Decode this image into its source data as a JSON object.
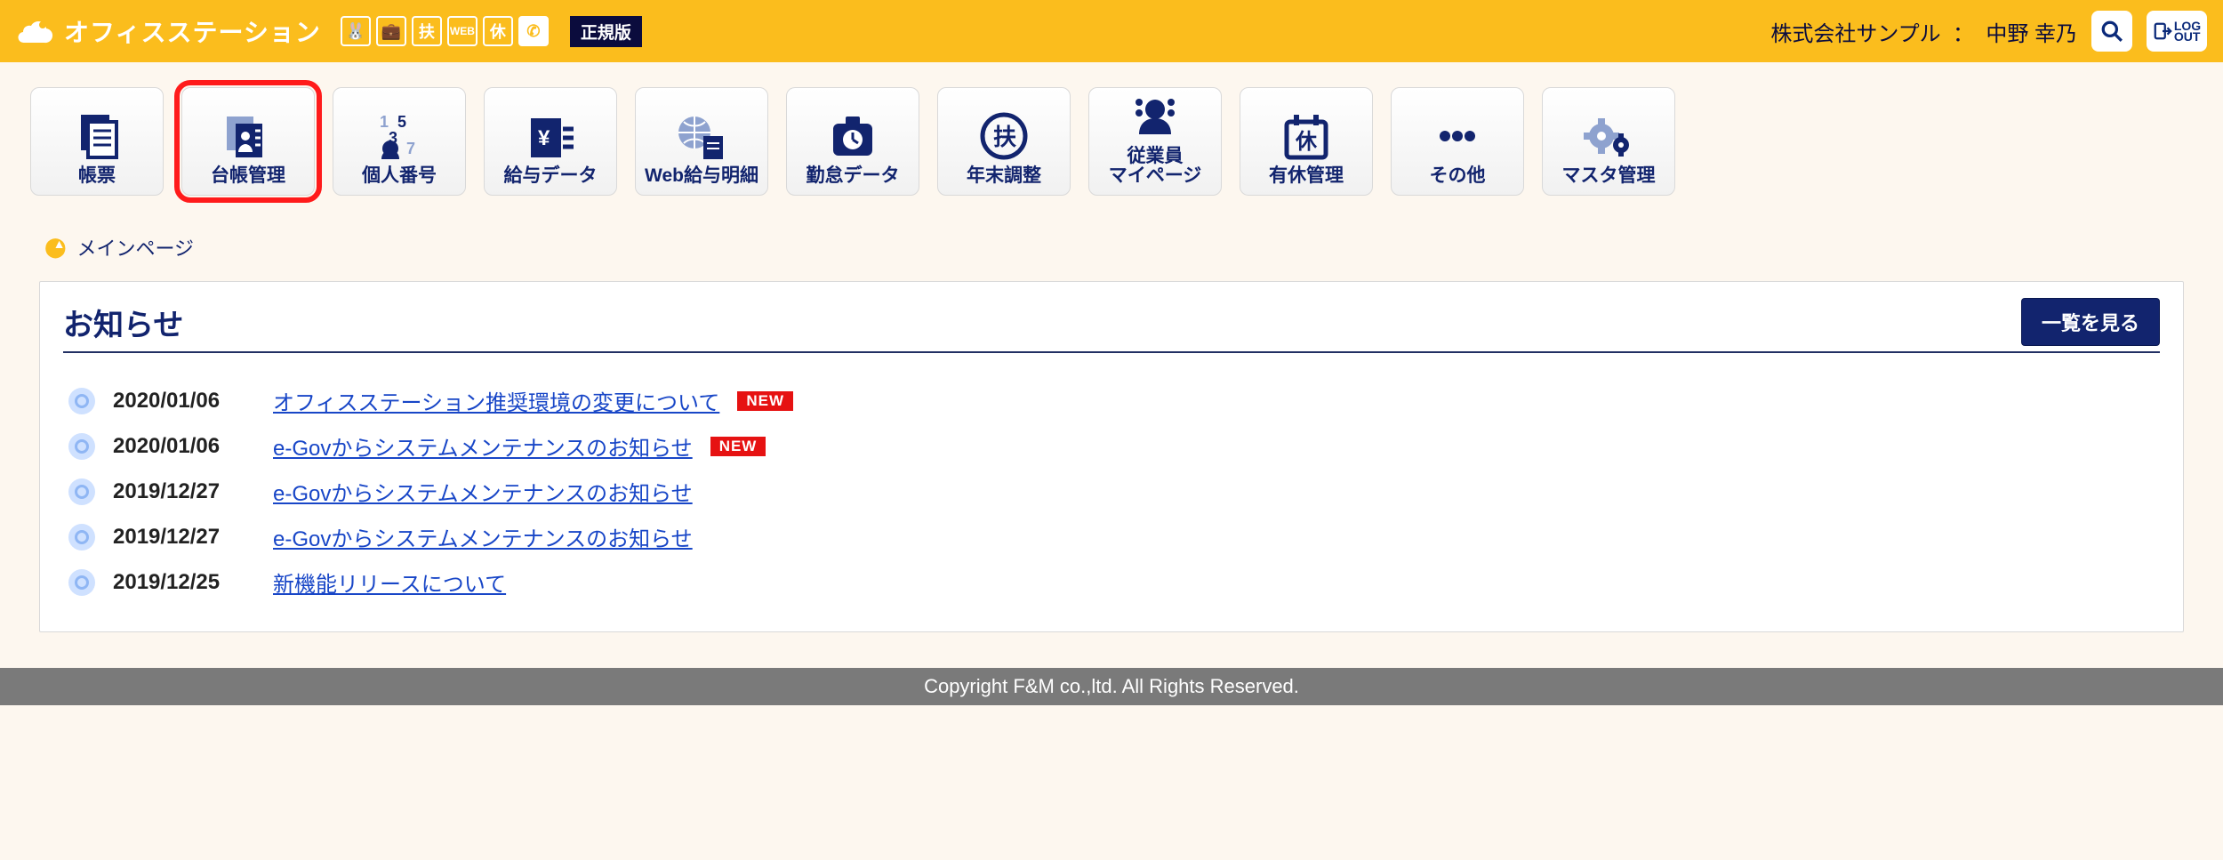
{
  "header": {
    "app_name": "オフィスステーション",
    "icons": [
      "rabbit-icon",
      "briefcase-icon",
      "tax-icon",
      "web-icon",
      "holiday-icon",
      "phone-icon"
    ],
    "version_badge": "正規版",
    "company": "株式会社サンプル",
    "separator": "：",
    "user": "中野 幸乃",
    "logout_label": "LOG\nOUT"
  },
  "nav": [
    {
      "id": "reports",
      "label": "帳票"
    },
    {
      "id": "ledger",
      "label": "台帳管理",
      "highlight": true
    },
    {
      "id": "mynumber",
      "label": "個人番号"
    },
    {
      "id": "salary",
      "label": "給与データ"
    },
    {
      "id": "payslip",
      "label": "Web給与明細"
    },
    {
      "id": "attendance",
      "label": "勤怠データ"
    },
    {
      "id": "yearend",
      "label": "年末調整"
    },
    {
      "id": "mypage",
      "label": "従業員\nマイページ"
    },
    {
      "id": "leave",
      "label": "有休管理"
    },
    {
      "id": "other",
      "label": "その他"
    },
    {
      "id": "master",
      "label": "マスタ管理"
    }
  ],
  "breadcrumb": {
    "label": "メインページ"
  },
  "panel": {
    "title": "お知らせ",
    "view_all": "一覧を見る"
  },
  "news": [
    {
      "date": "2020/01/06",
      "title": "オフィスステーション推奨環境の変更について",
      "new": true
    },
    {
      "date": "2020/01/06",
      "title": "e-Govからシステムメンテナンスのお知らせ",
      "new": true
    },
    {
      "date": "2019/12/27",
      "title": "e-Govからシステムメンテナンスのお知らせ",
      "new": false
    },
    {
      "date": "2019/12/27",
      "title": "e-Govからシステムメンテナンスのお知らせ",
      "new": false
    },
    {
      "date": "2019/12/25",
      "title": "新機能リリースについて",
      "new": false
    }
  ],
  "new_badge_label": "NEW",
  "footer": "Copyright F&M co.,ltd. All Rights Reserved."
}
